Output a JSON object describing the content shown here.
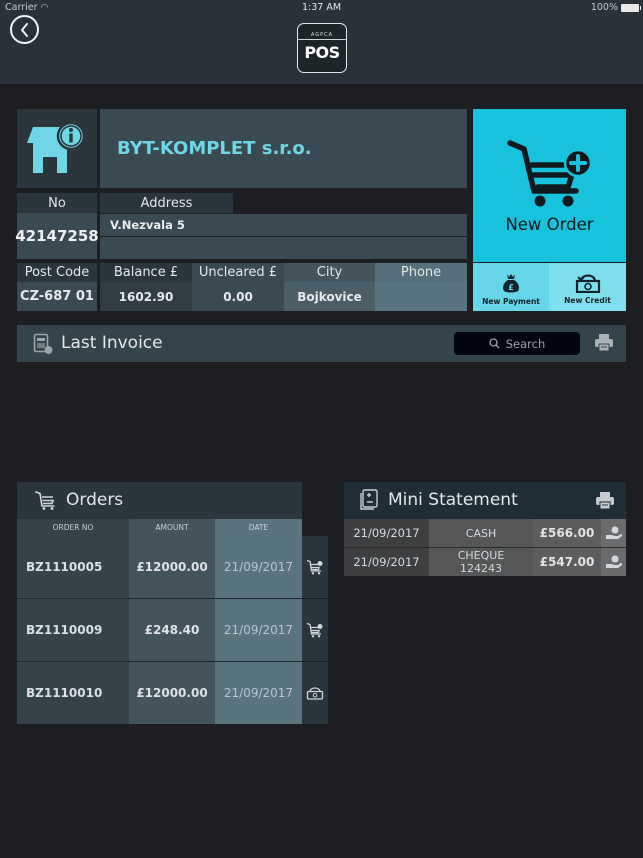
{
  "status_bar": {
    "carrier": "Carrier",
    "time": "1:37 AM",
    "battery": "100%"
  },
  "nav": {
    "back_icon": "chevron-left-icon",
    "logo_brand": "AGPCA",
    "logo_text": "POS"
  },
  "customer": {
    "name": "BYT-KOMPLET s.r.o.",
    "icon": "store-info-icon",
    "no_label": "No",
    "no_value": "42147258",
    "address_label": "Address",
    "address_line1": "V.Nezvala 5",
    "address_line2": "",
    "postcode_label": "Post Code",
    "postcode_value": "CZ-687 01",
    "balance_label": "Balance £",
    "balance_value": "1602.90",
    "uncleared_label": "Uncleared £",
    "uncleared_value": "0.00",
    "city_label": "City",
    "city_value": "Bojkovice",
    "phone_label": "Phone",
    "phone_value": ""
  },
  "actions": {
    "new_order": "New Order",
    "new_payment": "New Payment",
    "new_credit": "New Credit",
    "colors": {
      "primary": "#17c2dc",
      "secondary_left": "#66d7e8",
      "secondary_right": "#80dfed"
    }
  },
  "last_invoice": {
    "title": "Last Invoice",
    "search_placeholder": "Search"
  },
  "orders": {
    "title": "Orders",
    "columns": [
      "ORDER NO",
      "AMOUNT",
      "DATE"
    ],
    "rows": [
      {
        "order_no": "BZ1110005",
        "amount": "£12000.00",
        "date": "21/09/2017",
        "icon": "cart-icon"
      },
      {
        "order_no": "BZ1110009",
        "amount": "£248.40",
        "date": "21/09/2017",
        "icon": "cart-icon"
      },
      {
        "order_no": "BZ1110010",
        "amount": "£12000.00",
        "date": "21/09/2017",
        "icon": "credit-icon"
      }
    ]
  },
  "mini_statement": {
    "title": "Mini Statement",
    "rows": [
      {
        "date": "21/09/2017",
        "type": "CASH",
        "type_ref": "",
        "amount": "£566.00"
      },
      {
        "date": "21/09/2017",
        "type": "CHEQUE",
        "type_ref": "124243",
        "amount": "£547.00"
      }
    ]
  }
}
